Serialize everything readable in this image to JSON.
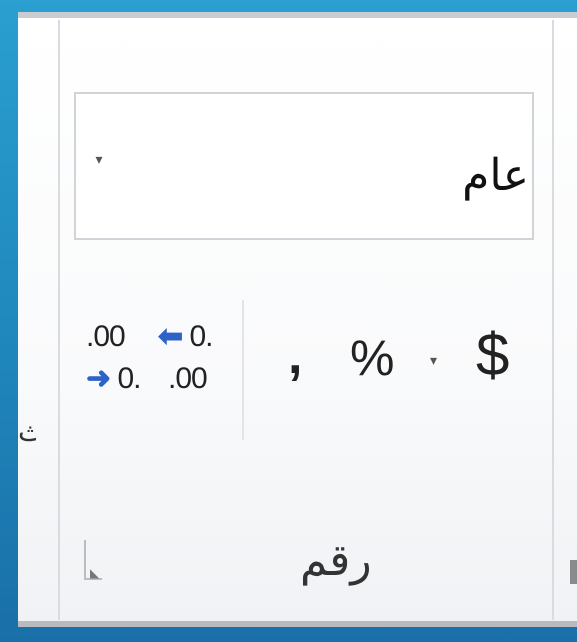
{
  "number_format": {
    "selected": "عام"
  },
  "buttons": {
    "decrease_top": ".00",
    "decrease_bottom": "0.",
    "increase_top": "0.",
    "increase_bottom": ".00",
    "comma": ",",
    "percent": "%",
    "currency": "$"
  },
  "group_label": "رقم",
  "icons": {
    "dropdown": "chevron-down-icon",
    "decimal_decrease": "decrease-decimal-icon",
    "decimal_increase": "increase-decimal-icon",
    "launcher": "dialog-launcher-icon"
  }
}
